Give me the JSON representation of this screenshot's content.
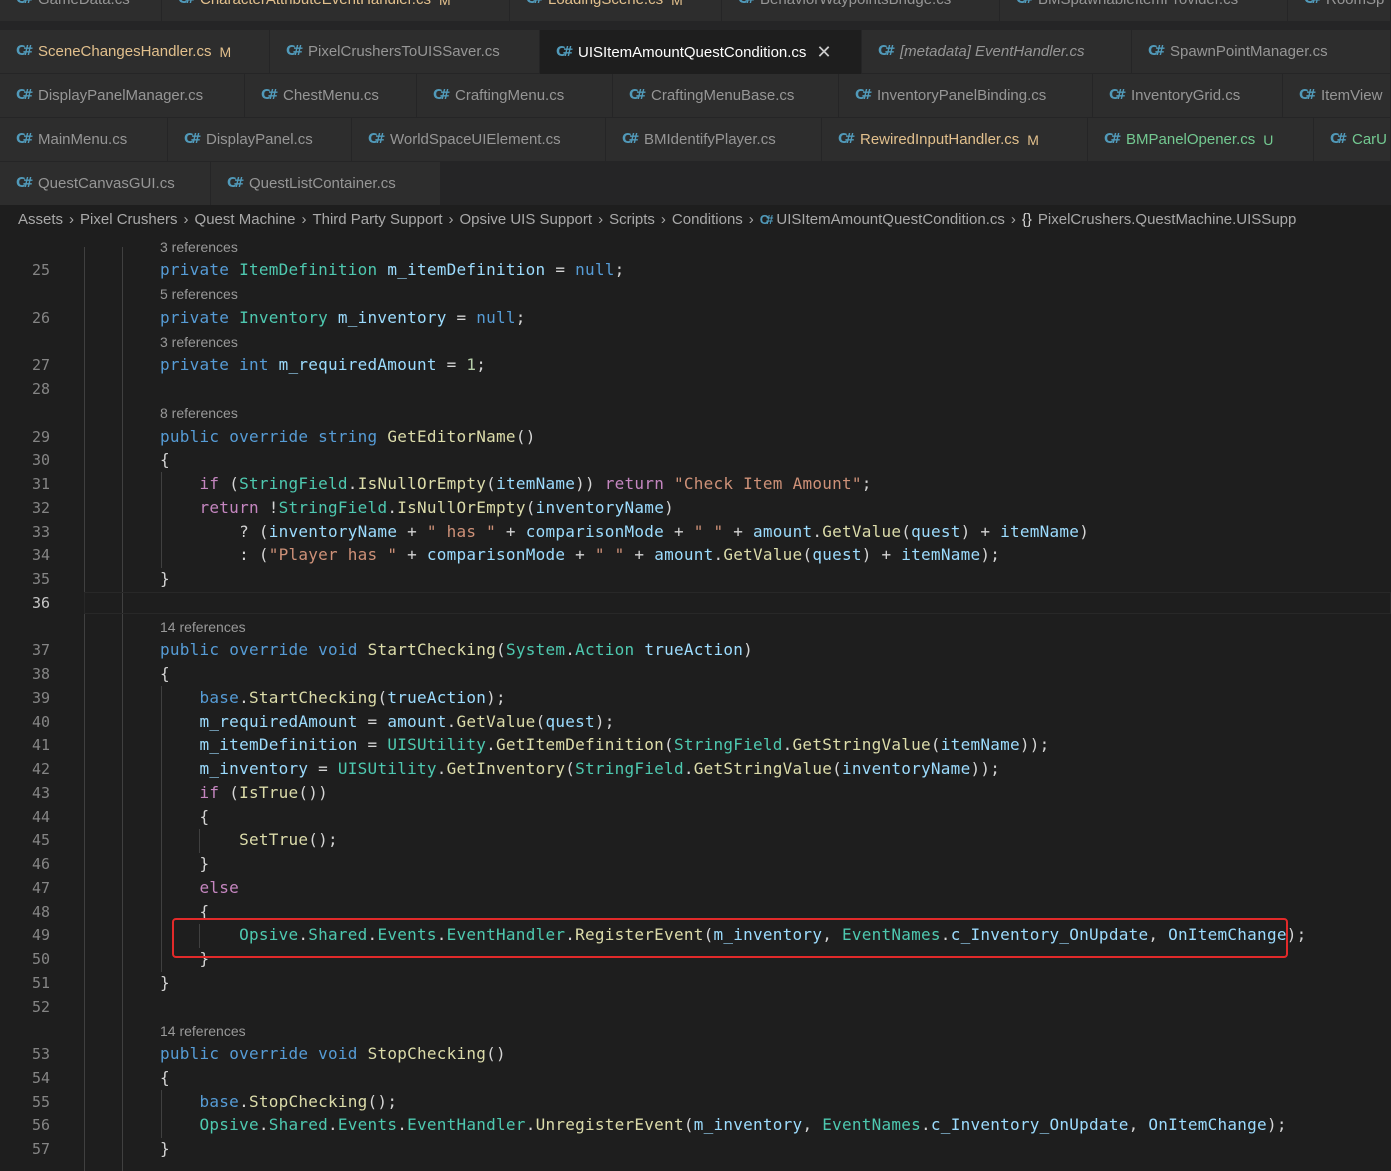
{
  "tab_rows": [
    [
      {
        "label": "GameData.cs",
        "badge": "",
        "state": ""
      },
      {
        "label": "CharacterAttributeEventHandler.cs",
        "badge": "M",
        "state": "modified"
      },
      {
        "label": "LoadingScene.cs",
        "badge": "M",
        "state": "modified"
      },
      {
        "label": "BehaviorWaypointsBridge.cs",
        "badge": "",
        "state": ""
      },
      {
        "label": "BMSpawnableItemProvider.cs",
        "badge": "",
        "state": ""
      },
      {
        "label": "RoomSp",
        "badge": "",
        "state": ""
      }
    ],
    [
      {
        "label": "SceneChangesHandler.cs",
        "badge": "M",
        "state": "modified"
      },
      {
        "label": "PixelCrushersToUISSaver.cs",
        "badge": "",
        "state": ""
      },
      {
        "label": "UISItemAmountQuestCondition.cs",
        "badge": "",
        "state": "active"
      },
      {
        "label": "[metadata] EventHandler.cs",
        "badge": "",
        "state": "italic"
      },
      {
        "label": "SpawnPointManager.cs",
        "badge": "",
        "state": ""
      }
    ],
    [
      {
        "label": "DisplayPanelManager.cs",
        "badge": "",
        "state": ""
      },
      {
        "label": "ChestMenu.cs",
        "badge": "",
        "state": ""
      },
      {
        "label": "CraftingMenu.cs",
        "badge": "",
        "state": ""
      },
      {
        "label": "CraftingMenuBase.cs",
        "badge": "",
        "state": ""
      },
      {
        "label": "InventoryPanelBinding.cs",
        "badge": "",
        "state": ""
      },
      {
        "label": "InventoryGrid.cs",
        "badge": "",
        "state": ""
      },
      {
        "label": "ItemView",
        "badge": "",
        "state": ""
      }
    ],
    [
      {
        "label": "MainMenu.cs",
        "badge": "",
        "state": ""
      },
      {
        "label": "DisplayPanel.cs",
        "badge": "",
        "state": ""
      },
      {
        "label": "WorldSpaceUIElement.cs",
        "badge": "",
        "state": ""
      },
      {
        "label": "BMIdentifyPlayer.cs",
        "badge": "",
        "state": ""
      },
      {
        "label": "RewiredInputHandler.cs",
        "badge": "M",
        "state": "modified"
      },
      {
        "label": "BMPanelOpener.cs",
        "badge": "U",
        "state": "untracked"
      },
      {
        "label": "CarU",
        "badge": "",
        "state": ""
      }
    ],
    [
      {
        "label": "QuestCanvasGUI.cs",
        "badge": "",
        "state": ""
      },
      {
        "label": "QuestListContainer.cs",
        "badge": "",
        "state": ""
      }
    ]
  ],
  "tab_icon_glyph": "C#",
  "tab_close_glyph": "✕",
  "breadcrumb": {
    "folders": [
      "Assets",
      "Pixel Crushers",
      "Quest Machine",
      "Third Party Support",
      "Opsive UIS Support",
      "Scripts",
      "Conditions"
    ],
    "file": "UISItemAmountQuestCondition.cs",
    "namespace_icon": "{}",
    "namespace": "PixelCrushers.QuestMachine.UISSupp",
    "separator": "›"
  },
  "editor": {
    "current_line": "36",
    "codelens": [
      "3 references",
      "5 references",
      "3 references",
      "8 references",
      "14 references",
      "14 references"
    ],
    "lines": [
      {
        "n": "25",
        "tokens": [
          [
            "kw",
            "private "
          ],
          [
            "ty",
            "ItemDefinition "
          ],
          [
            "var",
            "m_itemDefinition"
          ],
          [
            "pl",
            " = "
          ],
          [
            "kw",
            "null"
          ],
          [
            "pl",
            ";"
          ]
        ]
      },
      {
        "n": "26",
        "tokens": [
          [
            "kw",
            "private "
          ],
          [
            "ty",
            "Inventory "
          ],
          [
            "var",
            "m_inventory"
          ],
          [
            "pl",
            " = "
          ],
          [
            "kw",
            "null"
          ],
          [
            "pl",
            ";"
          ]
        ]
      },
      {
        "n": "27",
        "tokens": [
          [
            "kw",
            "private "
          ],
          [
            "kw",
            "int "
          ],
          [
            "var",
            "m_requiredAmount"
          ],
          [
            "pl",
            " = "
          ],
          [
            "num",
            "1"
          ],
          [
            "pl",
            ";"
          ]
        ]
      },
      {
        "n": "28",
        "tokens": []
      },
      {
        "n": "29",
        "tokens": [
          [
            "kw",
            "public "
          ],
          [
            "kw",
            "override "
          ],
          [
            "kw",
            "string "
          ],
          [
            "fn",
            "GetEditorName"
          ],
          [
            "pl",
            "()"
          ]
        ]
      },
      {
        "n": "30",
        "tokens": [
          [
            "pl",
            "{"
          ]
        ]
      },
      {
        "n": "31",
        "tokens": [
          [
            "pl",
            "    "
          ],
          [
            "ctl",
            "if "
          ],
          [
            "pl",
            "("
          ],
          [
            "ty",
            "StringField"
          ],
          [
            "pl",
            "."
          ],
          [
            "fn",
            "IsNullOrEmpty"
          ],
          [
            "pl",
            "("
          ],
          [
            "var",
            "itemName"
          ],
          [
            "pl",
            ")) "
          ],
          [
            "ctl",
            "return "
          ],
          [
            "str",
            "\"Check Item Amount\""
          ],
          [
            "pl",
            ";"
          ]
        ]
      },
      {
        "n": "32",
        "tokens": [
          [
            "pl",
            "    "
          ],
          [
            "ctl",
            "return "
          ],
          [
            "pl",
            "!"
          ],
          [
            "ty",
            "StringField"
          ],
          [
            "pl",
            "."
          ],
          [
            "fn",
            "IsNullOrEmpty"
          ],
          [
            "pl",
            "("
          ],
          [
            "var",
            "inventoryName"
          ],
          [
            "pl",
            ")"
          ]
        ]
      },
      {
        "n": "33",
        "tokens": [
          [
            "pl",
            "        ? ("
          ],
          [
            "var",
            "inventoryName"
          ],
          [
            "pl",
            " + "
          ],
          [
            "str",
            "\" has \""
          ],
          [
            "pl",
            " + "
          ],
          [
            "var",
            "comparisonMode"
          ],
          [
            "pl",
            " + "
          ],
          [
            "str",
            "\" \""
          ],
          [
            "pl",
            " + "
          ],
          [
            "var",
            "amount"
          ],
          [
            "pl",
            "."
          ],
          [
            "fn",
            "GetValue"
          ],
          [
            "pl",
            "("
          ],
          [
            "var",
            "quest"
          ],
          [
            "pl",
            ") + "
          ],
          [
            "var",
            "itemName"
          ],
          [
            "pl",
            ")"
          ]
        ]
      },
      {
        "n": "34",
        "tokens": [
          [
            "pl",
            "        : ("
          ],
          [
            "str",
            "\"Player has \""
          ],
          [
            "pl",
            " + "
          ],
          [
            "var",
            "comparisonMode"
          ],
          [
            "pl",
            " + "
          ],
          [
            "str",
            "\" \""
          ],
          [
            "pl",
            " + "
          ],
          [
            "var",
            "amount"
          ],
          [
            "pl",
            "."
          ],
          [
            "fn",
            "GetValue"
          ],
          [
            "pl",
            "("
          ],
          [
            "var",
            "quest"
          ],
          [
            "pl",
            ") + "
          ],
          [
            "var",
            "itemName"
          ],
          [
            "pl",
            ");"
          ]
        ]
      },
      {
        "n": "35",
        "tokens": [
          [
            "pl",
            "}"
          ]
        ]
      },
      {
        "n": "36",
        "tokens": []
      },
      {
        "n": "37",
        "tokens": [
          [
            "kw",
            "public "
          ],
          [
            "kw",
            "override "
          ],
          [
            "kw",
            "void "
          ],
          [
            "fn",
            "StartChecking"
          ],
          [
            "pl",
            "("
          ],
          [
            "ty",
            "System"
          ],
          [
            "pl",
            "."
          ],
          [
            "ty",
            "Action "
          ],
          [
            "var",
            "trueAction"
          ],
          [
            "pl",
            ")"
          ]
        ]
      },
      {
        "n": "38",
        "tokens": [
          [
            "pl",
            "{"
          ]
        ]
      },
      {
        "n": "39",
        "tokens": [
          [
            "pl",
            "    "
          ],
          [
            "kw",
            "base"
          ],
          [
            "pl",
            "."
          ],
          [
            "fn",
            "StartChecking"
          ],
          [
            "pl",
            "("
          ],
          [
            "var",
            "trueAction"
          ],
          [
            "pl",
            ");"
          ]
        ]
      },
      {
        "n": "40",
        "tokens": [
          [
            "pl",
            "    "
          ],
          [
            "var",
            "m_requiredAmount"
          ],
          [
            "pl",
            " = "
          ],
          [
            "var",
            "amount"
          ],
          [
            "pl",
            "."
          ],
          [
            "fn",
            "GetValue"
          ],
          [
            "pl",
            "("
          ],
          [
            "var",
            "quest"
          ],
          [
            "pl",
            ");"
          ]
        ]
      },
      {
        "n": "41",
        "tokens": [
          [
            "pl",
            "    "
          ],
          [
            "var",
            "m_itemDefinition"
          ],
          [
            "pl",
            " = "
          ],
          [
            "ty",
            "UISUtility"
          ],
          [
            "pl",
            "."
          ],
          [
            "fn",
            "GetItemDefinition"
          ],
          [
            "pl",
            "("
          ],
          [
            "ty",
            "StringField"
          ],
          [
            "pl",
            "."
          ],
          [
            "fn",
            "GetStringValue"
          ],
          [
            "pl",
            "("
          ],
          [
            "var",
            "itemName"
          ],
          [
            "pl",
            "));"
          ]
        ]
      },
      {
        "n": "42",
        "tokens": [
          [
            "pl",
            "    "
          ],
          [
            "var",
            "m_inventory"
          ],
          [
            "pl",
            " = "
          ],
          [
            "ty",
            "UISUtility"
          ],
          [
            "pl",
            "."
          ],
          [
            "fn",
            "GetInventory"
          ],
          [
            "pl",
            "("
          ],
          [
            "ty",
            "StringField"
          ],
          [
            "pl",
            "."
          ],
          [
            "fn",
            "GetStringValue"
          ],
          [
            "pl",
            "("
          ],
          [
            "var",
            "inventoryName"
          ],
          [
            "pl",
            "));"
          ]
        ]
      },
      {
        "n": "43",
        "tokens": [
          [
            "pl",
            "    "
          ],
          [
            "ctl",
            "if "
          ],
          [
            "pl",
            "("
          ],
          [
            "fn",
            "IsTrue"
          ],
          [
            "pl",
            "())"
          ]
        ]
      },
      {
        "n": "44",
        "tokens": [
          [
            "pl",
            "    {"
          ]
        ]
      },
      {
        "n": "45",
        "tokens": [
          [
            "pl",
            "        "
          ],
          [
            "fn",
            "SetTrue"
          ],
          [
            "pl",
            "();"
          ]
        ]
      },
      {
        "n": "46",
        "tokens": [
          [
            "pl",
            "    }"
          ]
        ]
      },
      {
        "n": "47",
        "tokens": [
          [
            "pl",
            "    "
          ],
          [
            "ctl",
            "else"
          ]
        ]
      },
      {
        "n": "48",
        "tokens": [
          [
            "pl",
            "    {"
          ]
        ]
      },
      {
        "n": "49",
        "tokens": [
          [
            "pl",
            "        "
          ],
          [
            "ty",
            "Opsive"
          ],
          [
            "pl",
            "."
          ],
          [
            "ty",
            "Shared"
          ],
          [
            "pl",
            "."
          ],
          [
            "ty",
            "Events"
          ],
          [
            "pl",
            "."
          ],
          [
            "ty",
            "EventHandler"
          ],
          [
            "pl",
            "."
          ],
          [
            "fn",
            "RegisterEvent"
          ],
          [
            "pl",
            "("
          ],
          [
            "var",
            "m_inventory"
          ],
          [
            "pl",
            ", "
          ],
          [
            "ty",
            "EventNames"
          ],
          [
            "pl",
            "."
          ],
          [
            "var",
            "c_Inventory_OnUpdate"
          ],
          [
            "pl",
            ", "
          ],
          [
            "var",
            "OnItemChange"
          ],
          [
            "pl",
            ");"
          ]
        ]
      },
      {
        "n": "50",
        "tokens": [
          [
            "pl",
            "    }"
          ]
        ]
      },
      {
        "n": "51",
        "tokens": [
          [
            "pl",
            "}"
          ]
        ]
      },
      {
        "n": "52",
        "tokens": []
      },
      {
        "n": "53",
        "tokens": [
          [
            "kw",
            "public "
          ],
          [
            "kw",
            "override "
          ],
          [
            "kw",
            "void "
          ],
          [
            "fn",
            "StopChecking"
          ],
          [
            "pl",
            "()"
          ]
        ]
      },
      {
        "n": "54",
        "tokens": [
          [
            "pl",
            "{"
          ]
        ]
      },
      {
        "n": "55",
        "tokens": [
          [
            "pl",
            "    "
          ],
          [
            "kw",
            "base"
          ],
          [
            "pl",
            "."
          ],
          [
            "fn",
            "StopChecking"
          ],
          [
            "pl",
            "();"
          ]
        ]
      },
      {
        "n": "56",
        "tokens": [
          [
            "pl",
            "    "
          ],
          [
            "ty",
            "Opsive"
          ],
          [
            "pl",
            "."
          ],
          [
            "ty",
            "Shared"
          ],
          [
            "pl",
            "."
          ],
          [
            "ty",
            "Events"
          ],
          [
            "pl",
            "."
          ],
          [
            "ty",
            "EventHandler"
          ],
          [
            "pl",
            "."
          ],
          [
            "fn",
            "UnregisterEvent"
          ],
          [
            "pl",
            "("
          ],
          [
            "var",
            "m_inventory"
          ],
          [
            "pl",
            ", "
          ],
          [
            "ty",
            "EventNames"
          ],
          [
            "pl",
            "."
          ],
          [
            "var",
            "c_Inventory_OnUpdate"
          ],
          [
            "pl",
            ", "
          ],
          [
            "var",
            "OnItemChange"
          ],
          [
            "pl",
            ");"
          ]
        ]
      },
      {
        "n": "57",
        "tokens": [
          [
            "pl",
            "}"
          ]
        ]
      }
    ]
  }
}
